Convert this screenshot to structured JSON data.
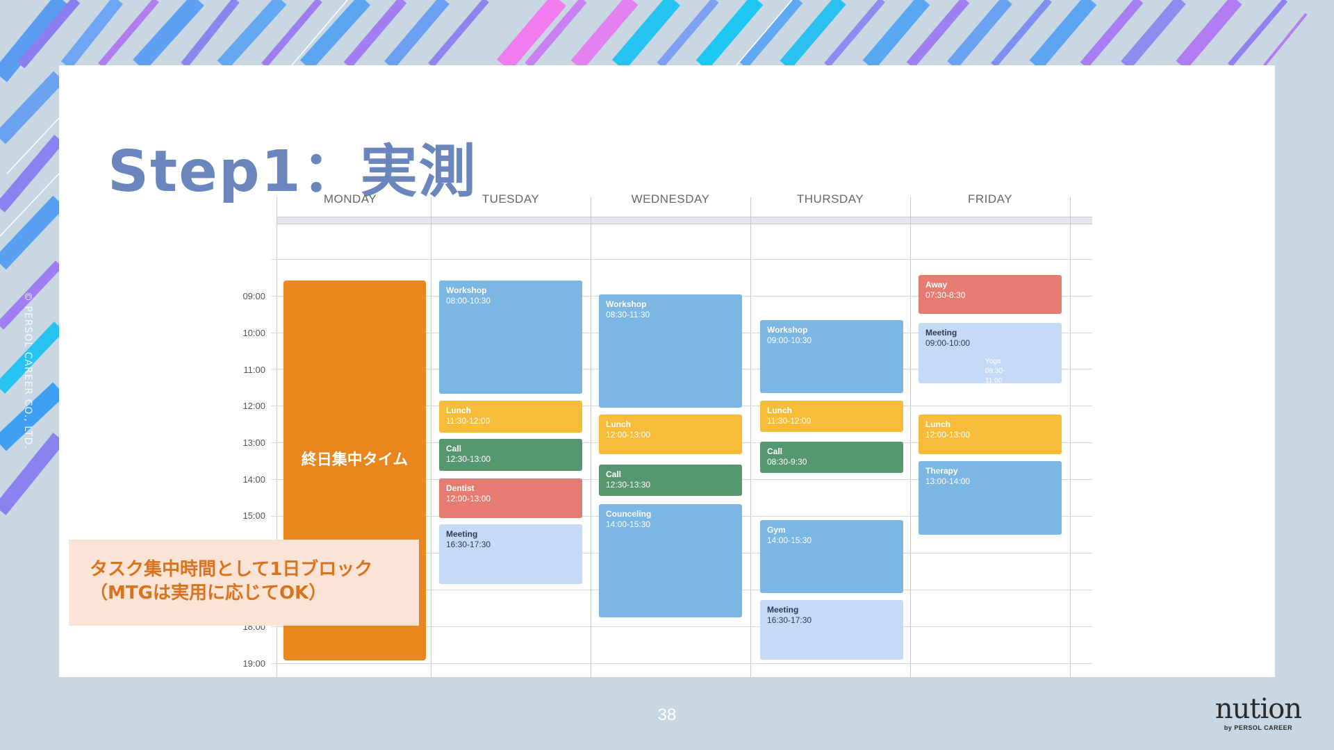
{
  "slide": {
    "title": "Step1：実測",
    "copyright": "© PERSOL CAREER CO., LTD.",
    "page_number": "38"
  },
  "calendar": {
    "days": [
      "MONDAY",
      "TUESDAY",
      "WEDNESDAY",
      "THURSDAY",
      "FRIDAY"
    ],
    "time_labels": [
      "09:00",
      "10:00",
      "11:00",
      "12:00",
      "13:00",
      "14:00",
      "15:00",
      "18:00",
      "19:00"
    ],
    "focus_block_label": "終日集中タイム",
    "tuesday": [
      {
        "name": "Workshop",
        "time": "08:00-10:30"
      },
      {
        "name": "Lunch",
        "time": "11:30-12:00"
      },
      {
        "name": "Call",
        "time": "12:30-13:00"
      },
      {
        "name": "Dentist",
        "time": "12:00-13:00"
      },
      {
        "name": "Meeting",
        "time": "16:30-17:30"
      }
    ],
    "wednesday": [
      {
        "name": "Workshop",
        "time": "08:30-11:30"
      },
      {
        "name": "Lunch",
        "time": "12:00-13:00"
      },
      {
        "name": "Call",
        "time": "12:30-13:30"
      },
      {
        "name": "Counceling",
        "time": "14:00-15:30"
      }
    ],
    "thursday": [
      {
        "name": "Workshop",
        "time": "09:00-10:30"
      },
      {
        "name": "Lunch",
        "time": "11:30-12:00"
      },
      {
        "name": "Call",
        "time": "08:30-9:30"
      },
      {
        "name": "Gym",
        "time": "14:00-15:30"
      },
      {
        "name": "Meeting",
        "time": "16:30-17:30"
      }
    ],
    "friday": [
      {
        "name": "Away",
        "time": "07:30-8:30"
      },
      {
        "name": "Meeting",
        "time": "09:00-10:00"
      },
      {
        "name": "Lunch",
        "time": "12:00-13:00"
      },
      {
        "name": "Therapy",
        "time": "13:00-14:00"
      }
    ],
    "friday_sub_event": {
      "name": "Yoga",
      "time": "09:30-11:00"
    }
  },
  "note": {
    "line1": "タスク集中時間として1日ブロック",
    "line2": "（MTGは実用に応じてOK）"
  },
  "logo": {
    "main": "nution",
    "sub": "by PERSOL CAREER"
  },
  "colors": {
    "background": "#c8d7e1",
    "title": "#6a86bc",
    "focus_block": "#ea861e",
    "event_blue": "#7cb6e3",
    "event_yellow": "#f6bc3a",
    "event_green": "#569770",
    "event_red": "#e67b72",
    "event_lightblue": "#c5daf7",
    "note_bg": "#fbe3d6",
    "note_text": "#d8731e"
  }
}
